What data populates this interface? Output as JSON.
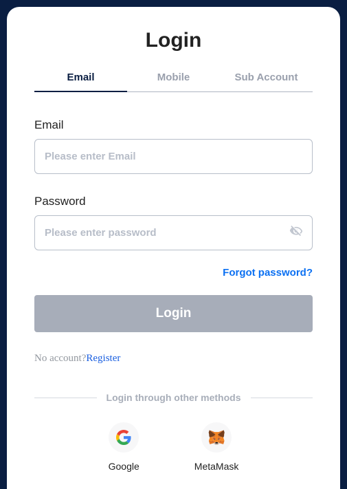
{
  "title": "Login",
  "tabs": [
    {
      "label": "Email",
      "active": true
    },
    {
      "label": "Mobile",
      "active": false
    },
    {
      "label": "Sub Account",
      "active": false
    }
  ],
  "email": {
    "label": "Email",
    "placeholder": "Please enter Email",
    "value": ""
  },
  "password": {
    "label": "Password",
    "placeholder": "Please enter password",
    "value": ""
  },
  "forgot": "Forgot password?",
  "login_button": "Login",
  "no_account_text": "No account?",
  "register_text": "Register",
  "divider_text": "Login through other methods",
  "methods": [
    {
      "name": "Google"
    },
    {
      "name": "MetaMask"
    }
  ]
}
